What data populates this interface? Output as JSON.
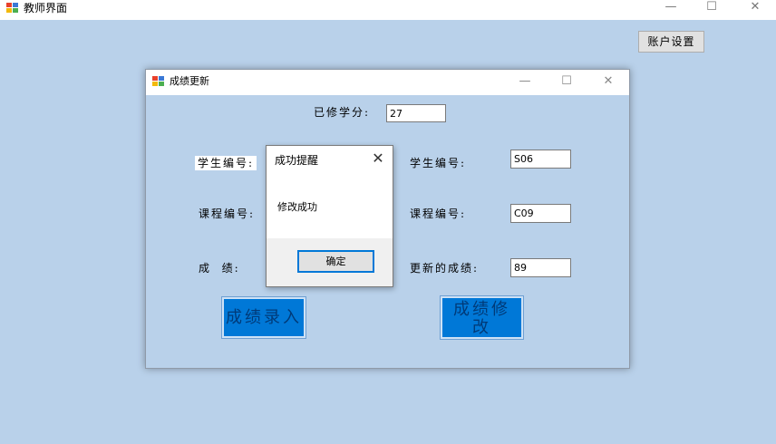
{
  "main_window": {
    "title": "教师界面",
    "controls": {
      "minimize": "—",
      "maximize": "☐",
      "close": "✕"
    }
  },
  "account_button": "账户设置",
  "child_window": {
    "title": "成绩更新",
    "controls": {
      "minimize": "—",
      "maximize": "☐",
      "close": "✕"
    },
    "credits_label": "已修学分:",
    "credits_value": "27",
    "left_form": {
      "student_id_label": "学生编号:",
      "course_id_label": "课程编号:",
      "grade_label": "成  绩:",
      "submit_button": "成绩录入"
    },
    "right_form": {
      "student_id_label": "学生编号:",
      "student_id_value": "S06",
      "course_id_label": "课程编号:",
      "course_id_value": "C09",
      "grade_label": "更新的成绩:",
      "grade_value": "89",
      "modify_button": "成绩修改"
    }
  },
  "message_box": {
    "title": "成功提醒",
    "close": "✕",
    "message": "修改成功",
    "ok_button": "确定"
  }
}
